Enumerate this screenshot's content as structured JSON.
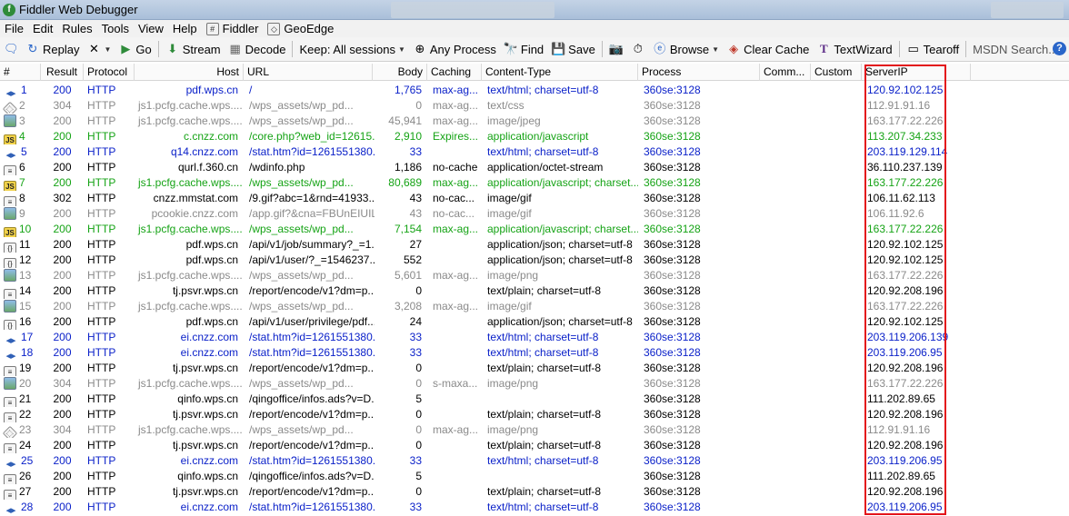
{
  "window": {
    "title": "Fiddler Web Debugger"
  },
  "menu": [
    "File",
    "Edit",
    "Rules",
    "Tools",
    "View",
    "Help",
    "Fiddler",
    "GeoEdge"
  ],
  "toolbar": {
    "replay": "Replay",
    "go": "Go",
    "stream": "Stream",
    "decode": "Decode",
    "keep": "Keep: All sessions",
    "any_process": "Any Process",
    "find": "Find",
    "save": "Save",
    "browse": "Browse",
    "clear_cache": "Clear Cache",
    "textwizard": "TextWizard",
    "tearoff": "Tearoff",
    "msdn_search": "MSDN Search..."
  },
  "columns": [
    "#",
    "Result",
    "Protocol",
    "Host",
    "URL",
    "Body",
    "Caching",
    "Content-Type",
    "Process",
    "Comm...",
    "Custom",
    "ServerIP"
  ],
  "colors": {
    "blue": "#0b21c9",
    "green": "#15a315",
    "gray": "#8a8a8a",
    "black": "#000000",
    "highlight": "#e3141b"
  },
  "sessions": [
    {
      "num": "1",
      "icon": "arrows",
      "color": "blue",
      "result": "200",
      "protocol": "HTTP",
      "host": "pdf.wps.cn",
      "url": "/",
      "body": "1,765",
      "caching": "max-ag...",
      "ctype": "text/html; charset=utf-8",
      "process": "360se:3128",
      "serverip": "120.92.102.125"
    },
    {
      "num": "2",
      "icon": "css",
      "color": "gray",
      "result": "304",
      "protocol": "HTTP",
      "host": "js1.pcfg.cache.wps....",
      "url": "/wps_assets/wp_pd...",
      "body": "0",
      "caching": "max-ag...",
      "ctype": "text/css",
      "process": "360se:3128",
      "serverip": "112.91.91.16"
    },
    {
      "num": "3",
      "icon": "img",
      "color": "gray",
      "result": "200",
      "protocol": "HTTP",
      "host": "js1.pcfg.cache.wps....",
      "url": "/wps_assets/wp_pd...",
      "body": "45,941",
      "caching": "max-ag...",
      "ctype": "image/jpeg",
      "process": "360se:3128",
      "serverip": "163.177.22.226"
    },
    {
      "num": "4",
      "icon": "js",
      "color": "green",
      "result": "200",
      "protocol": "HTTP",
      "host": "c.cnzz.com",
      "url": "/core.php?web_id=12615...",
      "body": "2,910",
      "caching": "Expires...",
      "ctype": "application/javascript",
      "process": "360se:3128",
      "serverip": "113.207.34.233"
    },
    {
      "num": "5",
      "icon": "arrows",
      "color": "blue",
      "result": "200",
      "protocol": "HTTP",
      "host": "q14.cnzz.com",
      "url": "/stat.htm?id=1261551380...",
      "body": "33",
      "caching": "",
      "ctype": "text/html; charset=utf-8",
      "process": "360se:3128",
      "serverip": "203.119.129.114"
    },
    {
      "num": "6",
      "icon": "doc",
      "color": "black",
      "result": "200",
      "protocol": "HTTP",
      "host": "qurl.f.360.cn",
      "url": "/wdinfo.php",
      "body": "1,186",
      "caching": "no-cache",
      "ctype": "application/octet-stream",
      "process": "360se:3128",
      "serverip": "36.110.237.139"
    },
    {
      "num": "7",
      "icon": "js",
      "color": "green",
      "result": "200",
      "protocol": "HTTP",
      "host": "js1.pcfg.cache.wps....",
      "url": "/wps_assets/wp_pd...",
      "body": "80,689",
      "caching": "max-ag...",
      "ctype": "application/javascript; charset...",
      "process": "360se:3128",
      "serverip": "163.177.22.226"
    },
    {
      "num": "8",
      "icon": "doc",
      "color": "black",
      "result": "302",
      "protocol": "HTTP",
      "host": "cnzz.mmstat.com",
      "url": "/9.gif?abc=1&rnd=41933...",
      "body": "43",
      "caching": "no-cac...",
      "ctype": "image/gif",
      "process": "360se:3128",
      "serverip": "106.11.62.113"
    },
    {
      "num": "9",
      "icon": "img",
      "color": "gray",
      "result": "200",
      "protocol": "HTTP",
      "host": "pcookie.cnzz.com",
      "url": "/app.gif?&cna=FBUnEIUILi...",
      "body": "43",
      "caching": "no-cac...",
      "ctype": "image/gif",
      "process": "360se:3128",
      "serverip": "106.11.92.6"
    },
    {
      "num": "10",
      "icon": "js",
      "color": "green",
      "result": "200",
      "protocol": "HTTP",
      "host": "js1.pcfg.cache.wps....",
      "url": "/wps_assets/wp_pd...",
      "body": "7,154",
      "caching": "max-ag...",
      "ctype": "application/javascript; charset...",
      "process": "360se:3128",
      "serverip": "163.177.22.226"
    },
    {
      "num": "11",
      "icon": "json",
      "color": "black",
      "result": "200",
      "protocol": "HTTP",
      "host": "pdf.wps.cn",
      "url": "/api/v1/job/summary?_=1...",
      "body": "27",
      "caching": "",
      "ctype": "application/json; charset=utf-8",
      "process": "360se:3128",
      "serverip": "120.92.102.125"
    },
    {
      "num": "12",
      "icon": "json",
      "color": "black",
      "result": "200",
      "protocol": "HTTP",
      "host": "pdf.wps.cn",
      "url": "/api/v1/user/?_=1546237...",
      "body": "552",
      "caching": "",
      "ctype": "application/json; charset=utf-8",
      "process": "360se:3128",
      "serverip": "120.92.102.125"
    },
    {
      "num": "13",
      "icon": "img",
      "color": "gray",
      "result": "200",
      "protocol": "HTTP",
      "host": "js1.pcfg.cache.wps....",
      "url": "/wps_assets/wp_pd...",
      "body": "5,601",
      "caching": "max-ag...",
      "ctype": "image/png",
      "process": "360se:3128",
      "serverip": "163.177.22.226"
    },
    {
      "num": "14",
      "icon": "doc",
      "color": "black",
      "result": "200",
      "protocol": "HTTP",
      "host": "tj.psvr.wps.cn",
      "url": "/report/encode/v1?dm=p...",
      "body": "0",
      "caching": "",
      "ctype": "text/plain; charset=utf-8",
      "process": "360se:3128",
      "serverip": "120.92.208.196"
    },
    {
      "num": "15",
      "icon": "img",
      "color": "gray",
      "result": "200",
      "protocol": "HTTP",
      "host": "js1.pcfg.cache.wps....",
      "url": "/wps_assets/wp_pd...",
      "body": "3,208",
      "caching": "max-ag...",
      "ctype": "image/gif",
      "process": "360se:3128",
      "serverip": "163.177.22.226"
    },
    {
      "num": "16",
      "icon": "json",
      "color": "black",
      "result": "200",
      "protocol": "HTTP",
      "host": "pdf.wps.cn",
      "url": "/api/v1/user/privilege/pdf...",
      "body": "24",
      "caching": "",
      "ctype": "application/json; charset=utf-8",
      "process": "360se:3128",
      "serverip": "120.92.102.125"
    },
    {
      "num": "17",
      "icon": "arrows",
      "color": "blue",
      "result": "200",
      "protocol": "HTTP",
      "host": "ei.cnzz.com",
      "url": "/stat.htm?id=1261551380...",
      "body": "33",
      "caching": "",
      "ctype": "text/html; charset=utf-8",
      "process": "360se:3128",
      "serverip": "203.119.206.139"
    },
    {
      "num": "18",
      "icon": "arrows",
      "color": "blue",
      "result": "200",
      "protocol": "HTTP",
      "host": "ei.cnzz.com",
      "url": "/stat.htm?id=1261551380...",
      "body": "33",
      "caching": "",
      "ctype": "text/html; charset=utf-8",
      "process": "360se:3128",
      "serverip": "203.119.206.95"
    },
    {
      "num": "19",
      "icon": "doc",
      "color": "black",
      "result": "200",
      "protocol": "HTTP",
      "host": "tj.psvr.wps.cn",
      "url": "/report/encode/v1?dm=p...",
      "body": "0",
      "caching": "",
      "ctype": "text/plain; charset=utf-8",
      "process": "360se:3128",
      "serverip": "120.92.208.196"
    },
    {
      "num": "20",
      "icon": "img",
      "color": "gray",
      "result": "304",
      "protocol": "HTTP",
      "host": "js1.pcfg.cache.wps....",
      "url": "/wps_assets/wp_pd...",
      "body": "0",
      "caching": "s-maxa...",
      "ctype": "image/png",
      "process": "360se:3128",
      "serverip": "163.177.22.226"
    },
    {
      "num": "21",
      "icon": "doc",
      "color": "black",
      "result": "200",
      "protocol": "HTTP",
      "host": "qinfo.wps.cn",
      "url": "/qingoffice/infos.ads?v=D...",
      "body": "5",
      "caching": "",
      "ctype": "",
      "process": "360se:3128",
      "serverip": "111.202.89.65"
    },
    {
      "num": "22",
      "icon": "doc",
      "color": "black",
      "result": "200",
      "protocol": "HTTP",
      "host": "tj.psvr.wps.cn",
      "url": "/report/encode/v1?dm=p...",
      "body": "0",
      "caching": "",
      "ctype": "text/plain; charset=utf-8",
      "process": "360se:3128",
      "serverip": "120.92.208.196"
    },
    {
      "num": "23",
      "icon": "css",
      "color": "gray",
      "result": "304",
      "protocol": "HTTP",
      "host": "js1.pcfg.cache.wps....",
      "url": "/wps_assets/wp_pd...",
      "body": "0",
      "caching": "max-ag...",
      "ctype": "image/png",
      "process": "360se:3128",
      "serverip": "112.91.91.16"
    },
    {
      "num": "24",
      "icon": "doc",
      "color": "black",
      "result": "200",
      "protocol": "HTTP",
      "host": "tj.psvr.wps.cn",
      "url": "/report/encode/v1?dm=p...",
      "body": "0",
      "caching": "",
      "ctype": "text/plain; charset=utf-8",
      "process": "360se:3128",
      "serverip": "120.92.208.196"
    },
    {
      "num": "25",
      "icon": "arrows",
      "color": "blue",
      "result": "200",
      "protocol": "HTTP",
      "host": "ei.cnzz.com",
      "url": "/stat.htm?id=1261551380...",
      "body": "33",
      "caching": "",
      "ctype": "text/html; charset=utf-8",
      "process": "360se:3128",
      "serverip": "203.119.206.95"
    },
    {
      "num": "26",
      "icon": "doc",
      "color": "black",
      "result": "200",
      "protocol": "HTTP",
      "host": "qinfo.wps.cn",
      "url": "/qingoffice/infos.ads?v=D...",
      "body": "5",
      "caching": "",
      "ctype": "",
      "process": "360se:3128",
      "serverip": "111.202.89.65"
    },
    {
      "num": "27",
      "icon": "doc",
      "color": "black",
      "result": "200",
      "protocol": "HTTP",
      "host": "tj.psvr.wps.cn",
      "url": "/report/encode/v1?dm=p...",
      "body": "0",
      "caching": "",
      "ctype": "text/plain; charset=utf-8",
      "process": "360se:3128",
      "serverip": "120.92.208.196"
    },
    {
      "num": "28",
      "icon": "arrows",
      "color": "blue",
      "result": "200",
      "protocol": "HTTP",
      "host": "ei.cnzz.com",
      "url": "/stat.htm?id=1261551380...",
      "body": "33",
      "caching": "",
      "ctype": "text/html; charset=utf-8",
      "process": "360se:3128",
      "serverip": "203.119.206.95"
    }
  ]
}
